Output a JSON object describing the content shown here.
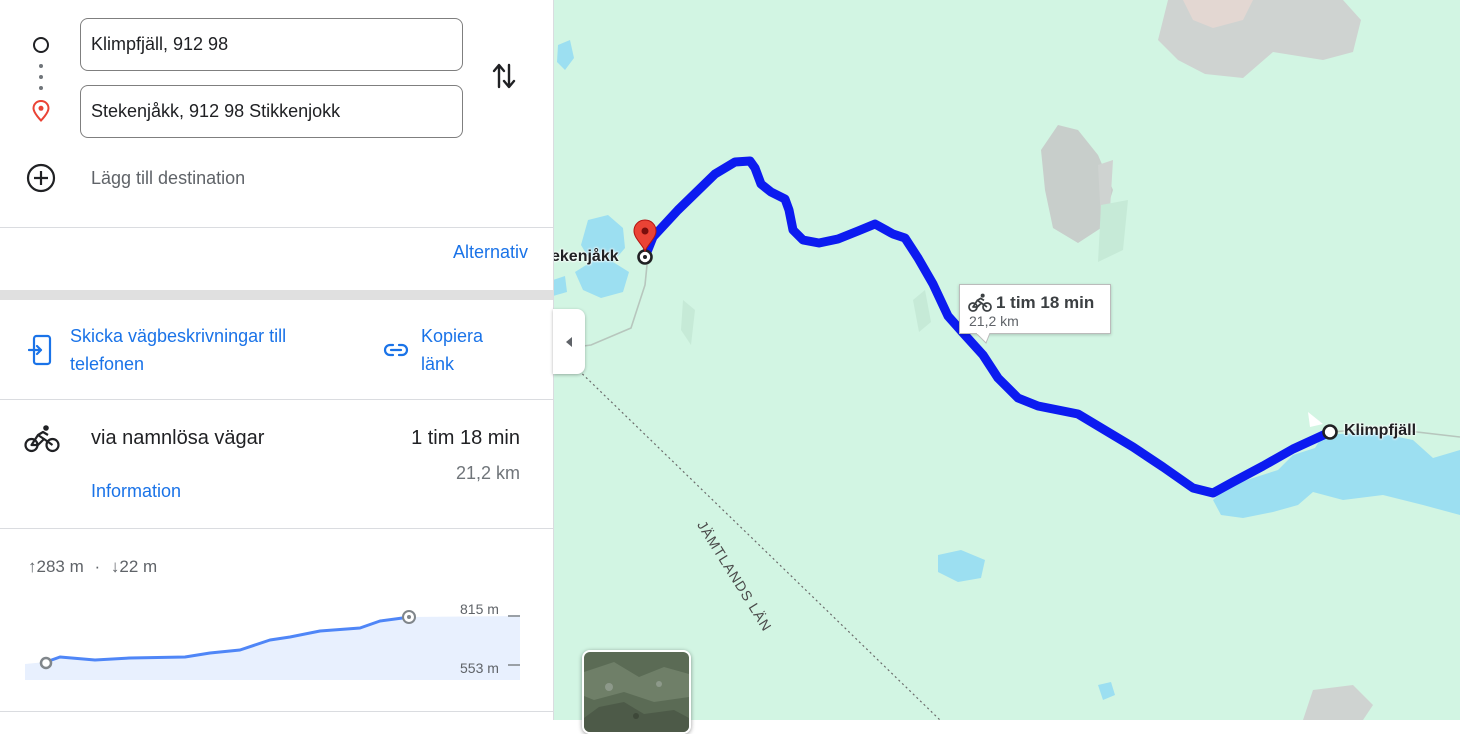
{
  "directions": {
    "origin_value": "Klimpfjäll, 912 98",
    "destination_value": "Stekenjåkk, 912 98 Stikkenjokk",
    "add_destination_label": "Lägg till destination",
    "options_label": "Alternativ"
  },
  "actions": {
    "send_to_phone_label": "Skicka vägbeskrivningar till telefonen",
    "copy_link_label": "Kopiera länk"
  },
  "route": {
    "mode_icon": "bicycle-icon",
    "title": "via namnlösa vägar",
    "duration": "1 tim 18 min",
    "distance": "21,2 km",
    "details_link": "Information"
  },
  "elevation": {
    "ascent": "283 m",
    "separator": "·",
    "descent": "22 m",
    "max_label": "815 m",
    "min_label": "553 m"
  },
  "map": {
    "label_destination": "Stekenjåkk",
    "label_origin": "Klimpfjäll",
    "region_label": "JÄMTLANDS LÄN",
    "tooltip_duration": "1 tim 18 min",
    "tooltip_distance": "21,2 km"
  },
  "colors": {
    "accent": "#1a73e8",
    "route": "#0c1bf0",
    "map_land": "#d2f5e3",
    "water": "#9cdff1",
    "pin": "#ea4335"
  }
}
